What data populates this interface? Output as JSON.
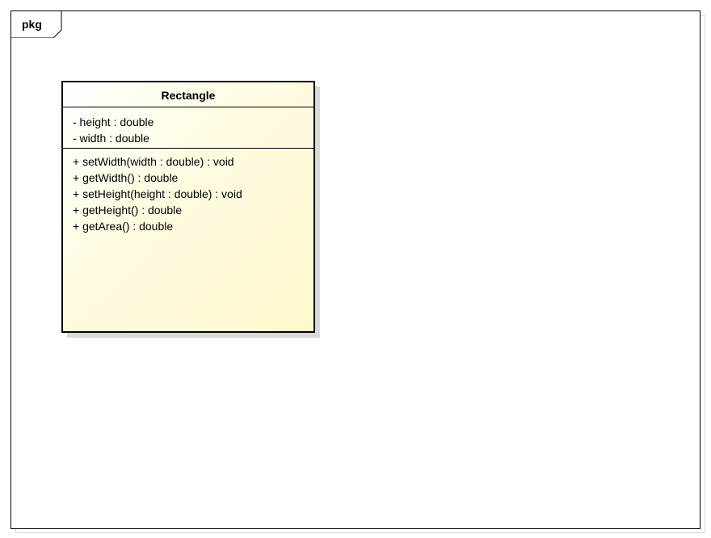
{
  "package": {
    "label": "pkg"
  },
  "class": {
    "name": "Rectangle",
    "attributes": [
      "- height : double",
      "- width : double"
    ],
    "operations": [
      "+ setWidth(width : double) : void",
      "+ getWidth() : double",
      "+ setHeight(height : double) : void",
      "+ getHeight() : double",
      "+ getArea() : double"
    ]
  },
  "colors": {
    "class_fill": "#fff9cf",
    "border": "#000000",
    "shadow": "#d9d9d9"
  }
}
